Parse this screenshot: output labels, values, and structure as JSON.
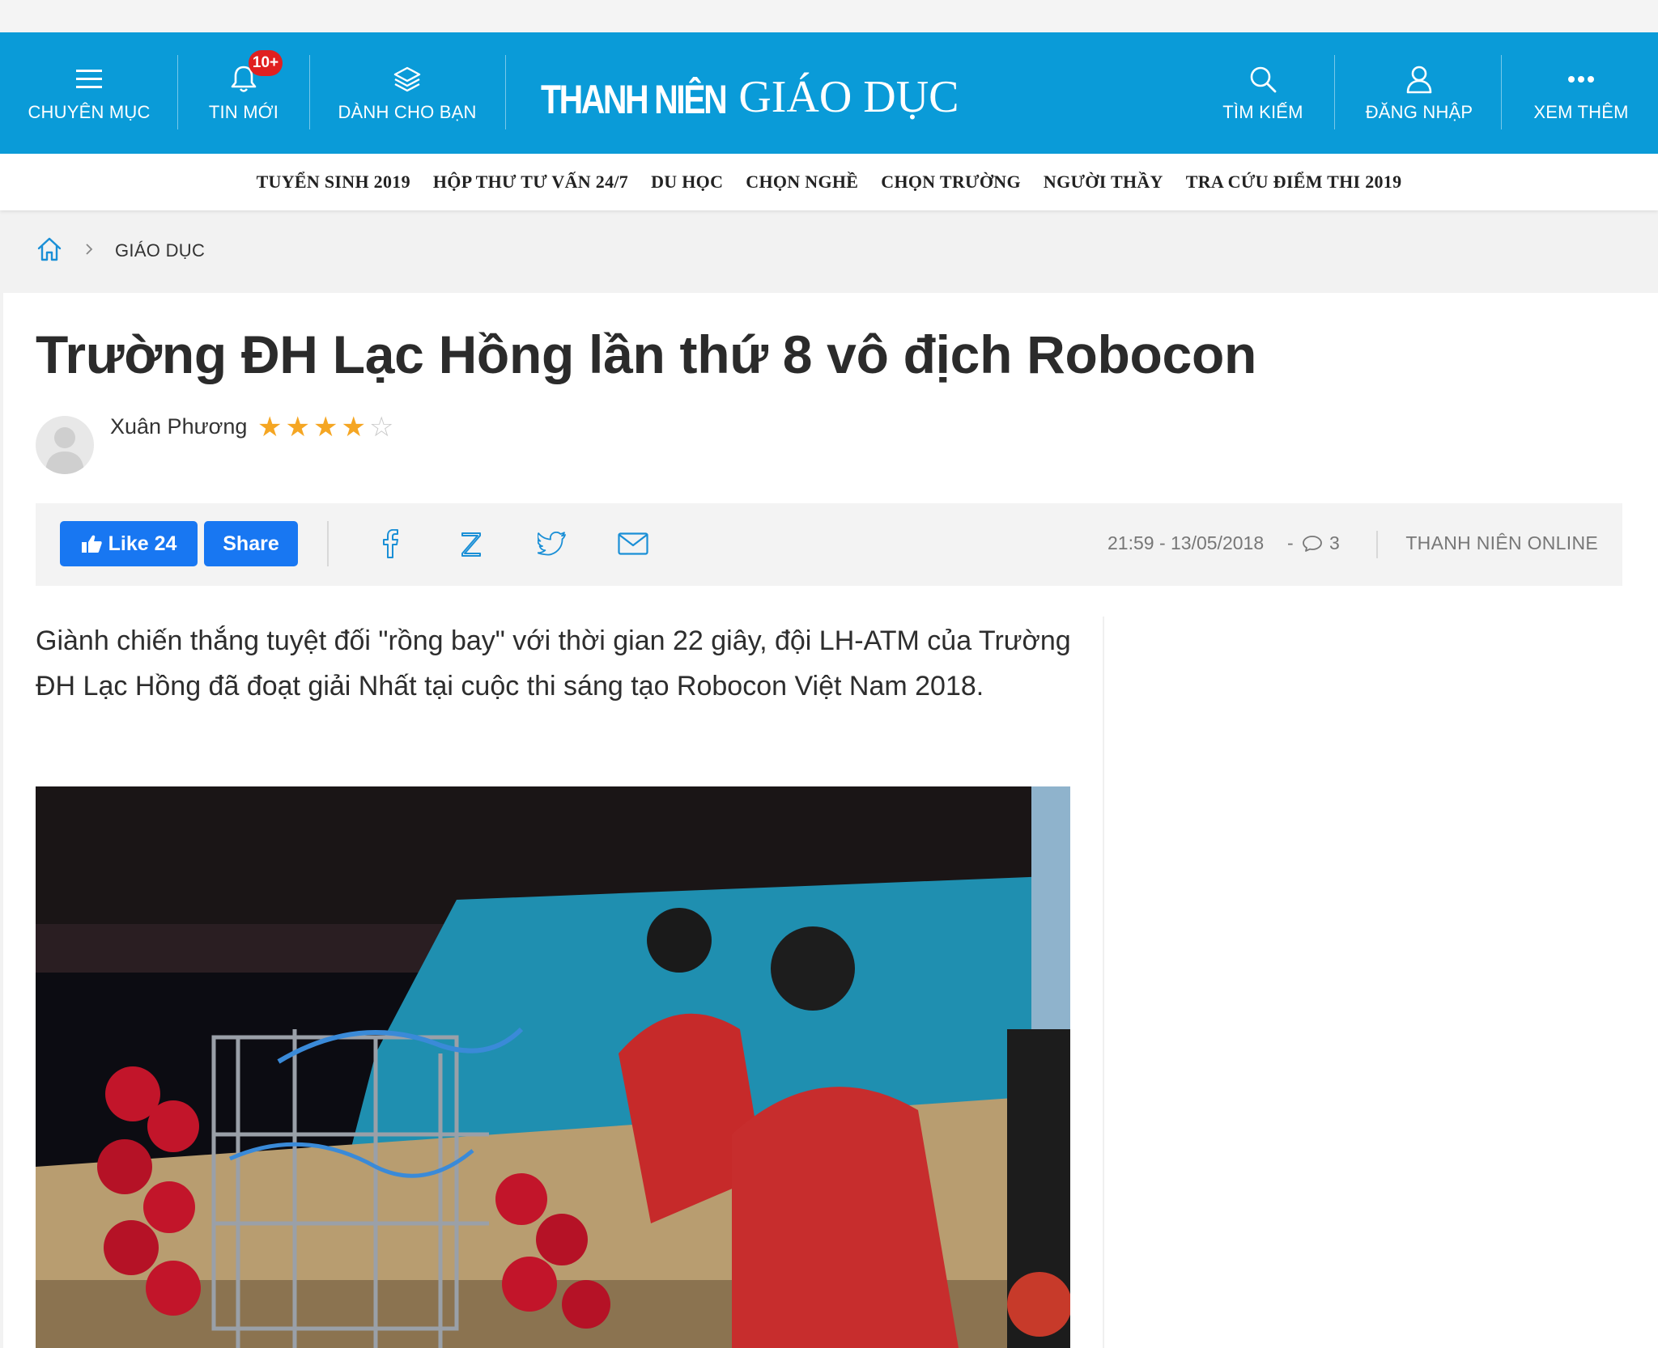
{
  "header": {
    "items": [
      {
        "label": "CHUYÊN MỤC",
        "icon": "menu-icon"
      },
      {
        "label": "TIN MỚI",
        "icon": "bell-icon",
        "badge": "10+"
      },
      {
        "label": "DÀNH CHO BẠN",
        "icon": "layers-icon"
      },
      {
        "label": "TÌM KIẾM",
        "icon": "search-icon"
      },
      {
        "label": "ĐĂNG NHẬP",
        "icon": "user-icon"
      },
      {
        "label": "XEM THÊM",
        "icon": "more-icon"
      }
    ],
    "logo_brand": "THANH NIÊN",
    "logo_section": "GIÁO DỤC",
    "color": "#0a9bd8"
  },
  "subnav": [
    "TUYỂN SINH 2019",
    "HỘP THƯ TƯ VẤN 24/7",
    "DU HỌC",
    "CHỌN NGHỀ",
    "CHỌN TRƯỜNG",
    "NGƯỜI THẦY",
    "TRA CỨU ĐIỂM THI 2019"
  ],
  "breadcrumb": {
    "section": "GIÁO DỤC"
  },
  "article": {
    "title": "Trường ĐH Lạc Hồng lần thứ 8 vô địch Robocon",
    "author": "Xuân Phương",
    "rating": 4,
    "rating_max": 5,
    "datetime": "21:59 - 13/05/2018",
    "comments": "3",
    "source": "THANH NIÊN ONLINE",
    "sapo": "Giành chiến thắng tuyệt đối \"rồng bay\" với thời gian 22 giây, đội LH-ATM của Trường ĐH Lạc Hồng đã đoạt giải Nhất tại cuộc thi sáng tạo Robocon Việt Nam 2018."
  },
  "social": {
    "like_label": "Like 24",
    "share_label": "Share",
    "fb_color": "#1877f2",
    "icon_color": "#1a8fd6"
  }
}
